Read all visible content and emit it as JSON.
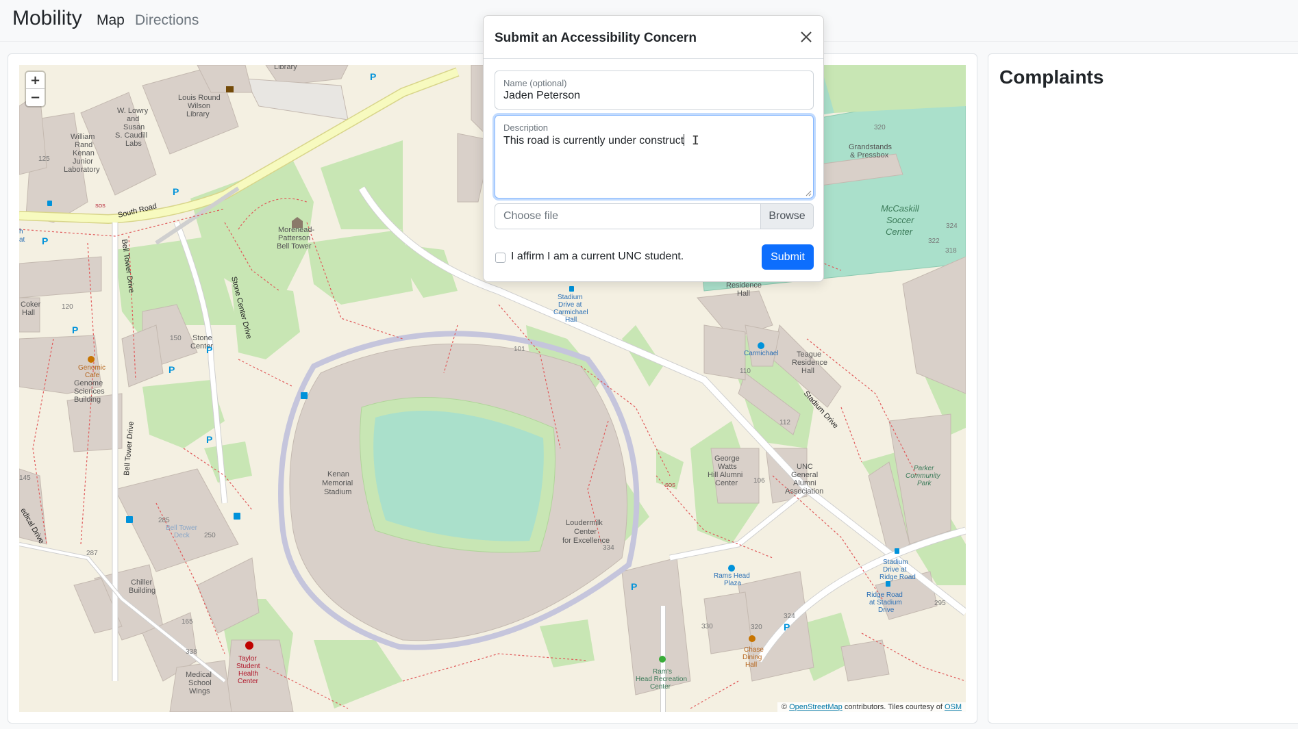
{
  "navbar": {
    "brand": "Mobility",
    "links": [
      {
        "label": "Map",
        "active": true
      },
      {
        "label": "Directions",
        "active": false
      }
    ]
  },
  "map": {
    "zoom_in": "+",
    "zoom_out": "−",
    "attribution": {
      "prefix": "©",
      "osm_link": "OpenStreetMap",
      "middle": "contributors. Tiles courtesy of",
      "tiles_link": "OSM"
    },
    "labels": {
      "library": "Library",
      "wilson_1": "Louis Round",
      "wilson_2": "Wilson",
      "wilson_3": "Library",
      "lowry_1": "W. Lowry",
      "lowry_2": "and",
      "lowry_3": "Susan",
      "lowry_4": "S. Caudill",
      "lowry_5": "Labs",
      "kenan_lab_1": "William",
      "kenan_lab_2": "Rand",
      "kenan_lab_3": "Kenan",
      "kenan_lab_4": "Junior",
      "kenan_lab_5": "Laboratory",
      "south_road": "South Road",
      "bell_tower_drive_1": "Bell Tower Drive",
      "bell_tower_drive_2": "Bell Tower Drive",
      "stone_center_drive": "Stone Center Drive",
      "bell_tower_1": "Morehead-",
      "bell_tower_2": "Patterson",
      "bell_tower_3": "Bell Tower",
      "coker_1": "Coker",
      "coker_2": "Hall",
      "stone_center_1": "Stone",
      "stone_center_2": "Center",
      "genome_cafe_1": "Genomic",
      "genome_cafe_2": "Cafe",
      "genome_1": "Genome",
      "genome_2": "Sciences",
      "genome_3": "Building",
      "kenan_stadium_1": "Kenan",
      "kenan_stadium_2": "Memorial",
      "kenan_stadium_3": "Stadium",
      "loudermilk_1": "Loudermilk",
      "loudermilk_2": "Center",
      "loudermilk_3": "for Excellence",
      "stadium_carmichael_1": "Stadium",
      "stadium_carmichael_2": "Drive at",
      "stadium_carmichael_3": "Carmichael",
      "stadium_carmichael_4": "Hall",
      "residence_1": "Residence",
      "residence_2": "Hall",
      "carmichael": "Carmichael",
      "teague_1": "Teague",
      "teague_2": "Residence",
      "teague_3": "Hall",
      "stadium_drive": "Stadium Drive",
      "george_watts_1": "George",
      "george_watts_2": "Watts",
      "george_watts_3": "Hill Alumni",
      "george_watts_4": "Center",
      "alumni_1": "UNC",
      "alumni_2": "General",
      "alumni_3": "Alumni",
      "alumni_4": "Association",
      "parker_1": "Parker",
      "parker_2": "Community",
      "parker_3": "Park",
      "grandstands_1": "Grandstands",
      "grandstands_2": "& Pressbox",
      "mccaskill_1": "McCaskill",
      "mccaskill_2": "Soccer",
      "mccaskill_3": "Center",
      "stadium_ridge_1": "Stadium",
      "stadium_ridge_2": "Drive at",
      "stadium_ridge_3": "Ridge Road",
      "ridge_stadium_1": "Ridge Road",
      "ridge_stadium_2": "at Stadium",
      "ridge_stadium_3": "Drive",
      "rams_head_plaza_1": "Rams Head",
      "rams_head_plaza_2": "Plaza",
      "rams_rec_1": "Ram's",
      "rams_rec_2": "Head Recreation",
      "rams_rec_3": "Center",
      "chase_1": "Chase",
      "chase_2": "Dining",
      "chase_3": "Hall",
      "bell_tower_deck_1": "Bell Tower",
      "bell_tower_deck_2": "Deck",
      "chiller_1": "Chiller",
      "chiller_2": "Building",
      "taylor_1": "Taylor",
      "taylor_2": "Student",
      "taylor_3": "Health",
      "taylor_4": "Center",
      "medical_1": "Medical",
      "medical_2": "School",
      "medical_3": "Wings",
      "medical_drive": "edical Drive",
      "hat": "h",
      "hat2": "at",
      "n125": "125",
      "n120": "120",
      "n150": "150",
      "n145": "145",
      "n285": "285",
      "n250": "250",
      "n287": "287",
      "n165": "165",
      "n338": "338",
      "n101": "101",
      "n110": "110",
      "n112": "112",
      "n106": "106",
      "n334": "334",
      "n330": "330",
      "n320a": "320",
      "n324a": "324",
      "n320b": "320",
      "n324b": "324",
      "n322": "322",
      "n318": "318",
      "n295": "295",
      "sos1": "SOS",
      "sos2": "SOS"
    }
  },
  "complaints": {
    "title": "Complaints"
  },
  "modal": {
    "title": "Submit an Accessibility Concern",
    "name_label": "Name (optional)",
    "name_value": "Jaden Peterson",
    "description_label": "Description",
    "description_value": "This road is currently under construct",
    "file_placeholder": "Choose file",
    "browse_label": "Browse",
    "checkbox_label": "I affirm I am a current UNC student.",
    "submit_label": "Submit"
  },
  "colors": {
    "primary": "#0d6efd",
    "map_background": "#f4f0e2",
    "building": "#d9d0c9",
    "park": "#c8e6b4",
    "pitch": "#aae0cb",
    "road_primary": "#f7fabf",
    "footway": "#e05a5a"
  }
}
